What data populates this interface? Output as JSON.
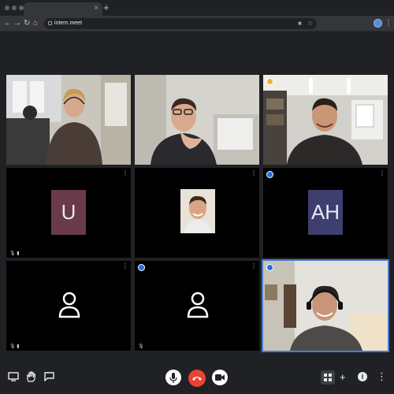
{
  "browser": {
    "url": "intern.meet",
    "new_tab_symbol": "+",
    "tab_close_symbol": "×"
  },
  "tiles": [
    {
      "kind": "video",
      "scene": "woman-with-headset"
    },
    {
      "kind": "video",
      "scene": "man-with-glasses"
    },
    {
      "kind": "video",
      "scene": "man-smiling"
    },
    {
      "kind": "initial",
      "label": "U",
      "color": "#6b3a49"
    },
    {
      "kind": "photo",
      "scene": "profile-photo"
    },
    {
      "kind": "initial",
      "label": "AH",
      "color": "#3e3f6f"
    },
    {
      "kind": "icon",
      "icon": "person-icon"
    },
    {
      "kind": "icon",
      "icon": "person-icon"
    },
    {
      "kind": "video",
      "scene": "man-with-headset",
      "active": true
    }
  ],
  "controls": {
    "left": [
      "present-icon",
      "raise-hand-icon",
      "chat-icon"
    ],
    "center": [
      "microphone-icon",
      "hang-up-icon",
      "camera-icon"
    ],
    "right": [
      "grid-view-icon",
      "add-icon",
      "info-icon",
      "more-icon"
    ]
  },
  "colors": {
    "background": "#202124",
    "hangup": "#ea4335",
    "tile": "#000000",
    "active_border": "#4a7bd1"
  }
}
